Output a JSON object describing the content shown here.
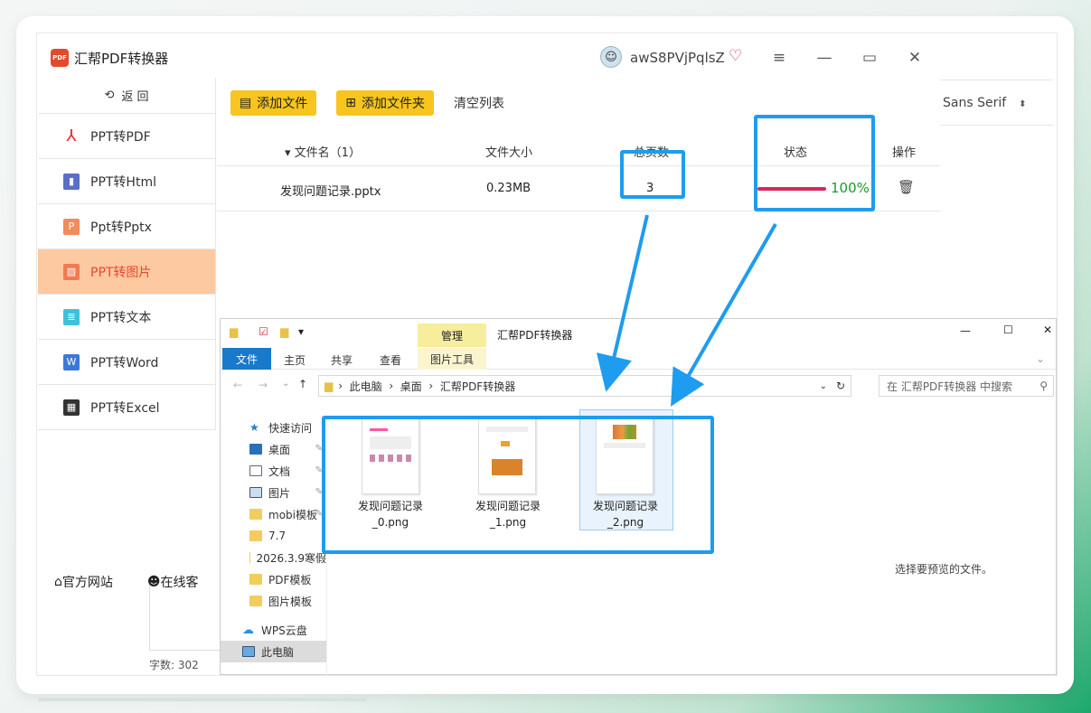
{
  "app": {
    "title": "汇帮PDF转换器",
    "logo_text": "PDF",
    "username": "awS8PVjPqlsZ",
    "colors": {
      "accent": "#f7c51e",
      "active_bg": "#fdc9a1",
      "active_text": "#e2492c",
      "highlight": "#1e9cef",
      "progress": "#d9265e",
      "done": "#1a9a2b"
    }
  },
  "sidebar": {
    "back_label": "返 回",
    "items": [
      {
        "label": "PPT转PDF",
        "icon": "pdf-icon"
      },
      {
        "label": "PPT转Html",
        "icon": "html-icon"
      },
      {
        "label": "Ppt转Pptx",
        "icon": "pptx-icon"
      },
      {
        "label": "PPT转图片",
        "icon": "image-icon",
        "active": true
      },
      {
        "label": "PPT转文本",
        "icon": "text-icon"
      },
      {
        "label": "PPT转Word",
        "icon": "word-icon"
      },
      {
        "label": "PPT转Excel",
        "icon": "excel-icon"
      }
    ]
  },
  "toolbar": {
    "add_file": "添加文件",
    "add_folder": "添加文件夹",
    "clear_list": "清空列表"
  },
  "table": {
    "headers": {
      "name": "文件名（1）",
      "size": "文件大小",
      "pages": "总页数",
      "status": "状态",
      "action": "操作"
    },
    "rows": [
      {
        "name": "发现问题记录.pptx",
        "size": "0.23MB",
        "pages": "3",
        "progress": "100%"
      }
    ]
  },
  "bottom": {
    "website": "官方网站",
    "support": "在线客"
  },
  "background_doc": {
    "font_name": "Sans Serif",
    "word_count": "字数: 302",
    "preview_hint": "选择要预览的文件。"
  },
  "explorer": {
    "title": "汇帮PDF转换器",
    "manage_tab": "管理",
    "ribbon": {
      "file": "文件",
      "home": "主页",
      "share": "共享",
      "view": "查看",
      "picture_tools": "图片工具"
    },
    "path": [
      "此电脑",
      "桌面",
      "汇帮PDF转换器"
    ],
    "search_placeholder": "在 汇帮PDF转换器 中搜索",
    "tree": [
      {
        "label": "快速访问",
        "icon": "star-icon"
      },
      {
        "label": "桌面",
        "icon": "desktop-icon"
      },
      {
        "label": "文档",
        "icon": "document-icon"
      },
      {
        "label": "图片",
        "icon": "pictures-icon"
      },
      {
        "label": "mobi模板",
        "icon": "folder-icon"
      },
      {
        "label": "7.7",
        "icon": "folder-icon"
      },
      {
        "label": "2026.3.9寒假",
        "icon": "folder-icon"
      },
      {
        "label": "PDF模板",
        "icon": "folder-icon"
      },
      {
        "label": "图片模板",
        "icon": "folder-icon"
      },
      {
        "label": "WPS云盘",
        "icon": "cloud-icon"
      },
      {
        "label": "此电脑",
        "icon": "computer-icon"
      }
    ],
    "files": [
      {
        "line1": "发现问题记录",
        "line2": "_0.png"
      },
      {
        "line1": "发现问题记录",
        "line2": "_1.png"
      },
      {
        "line1": "发现问题记录",
        "line2": "_2.png"
      }
    ]
  }
}
